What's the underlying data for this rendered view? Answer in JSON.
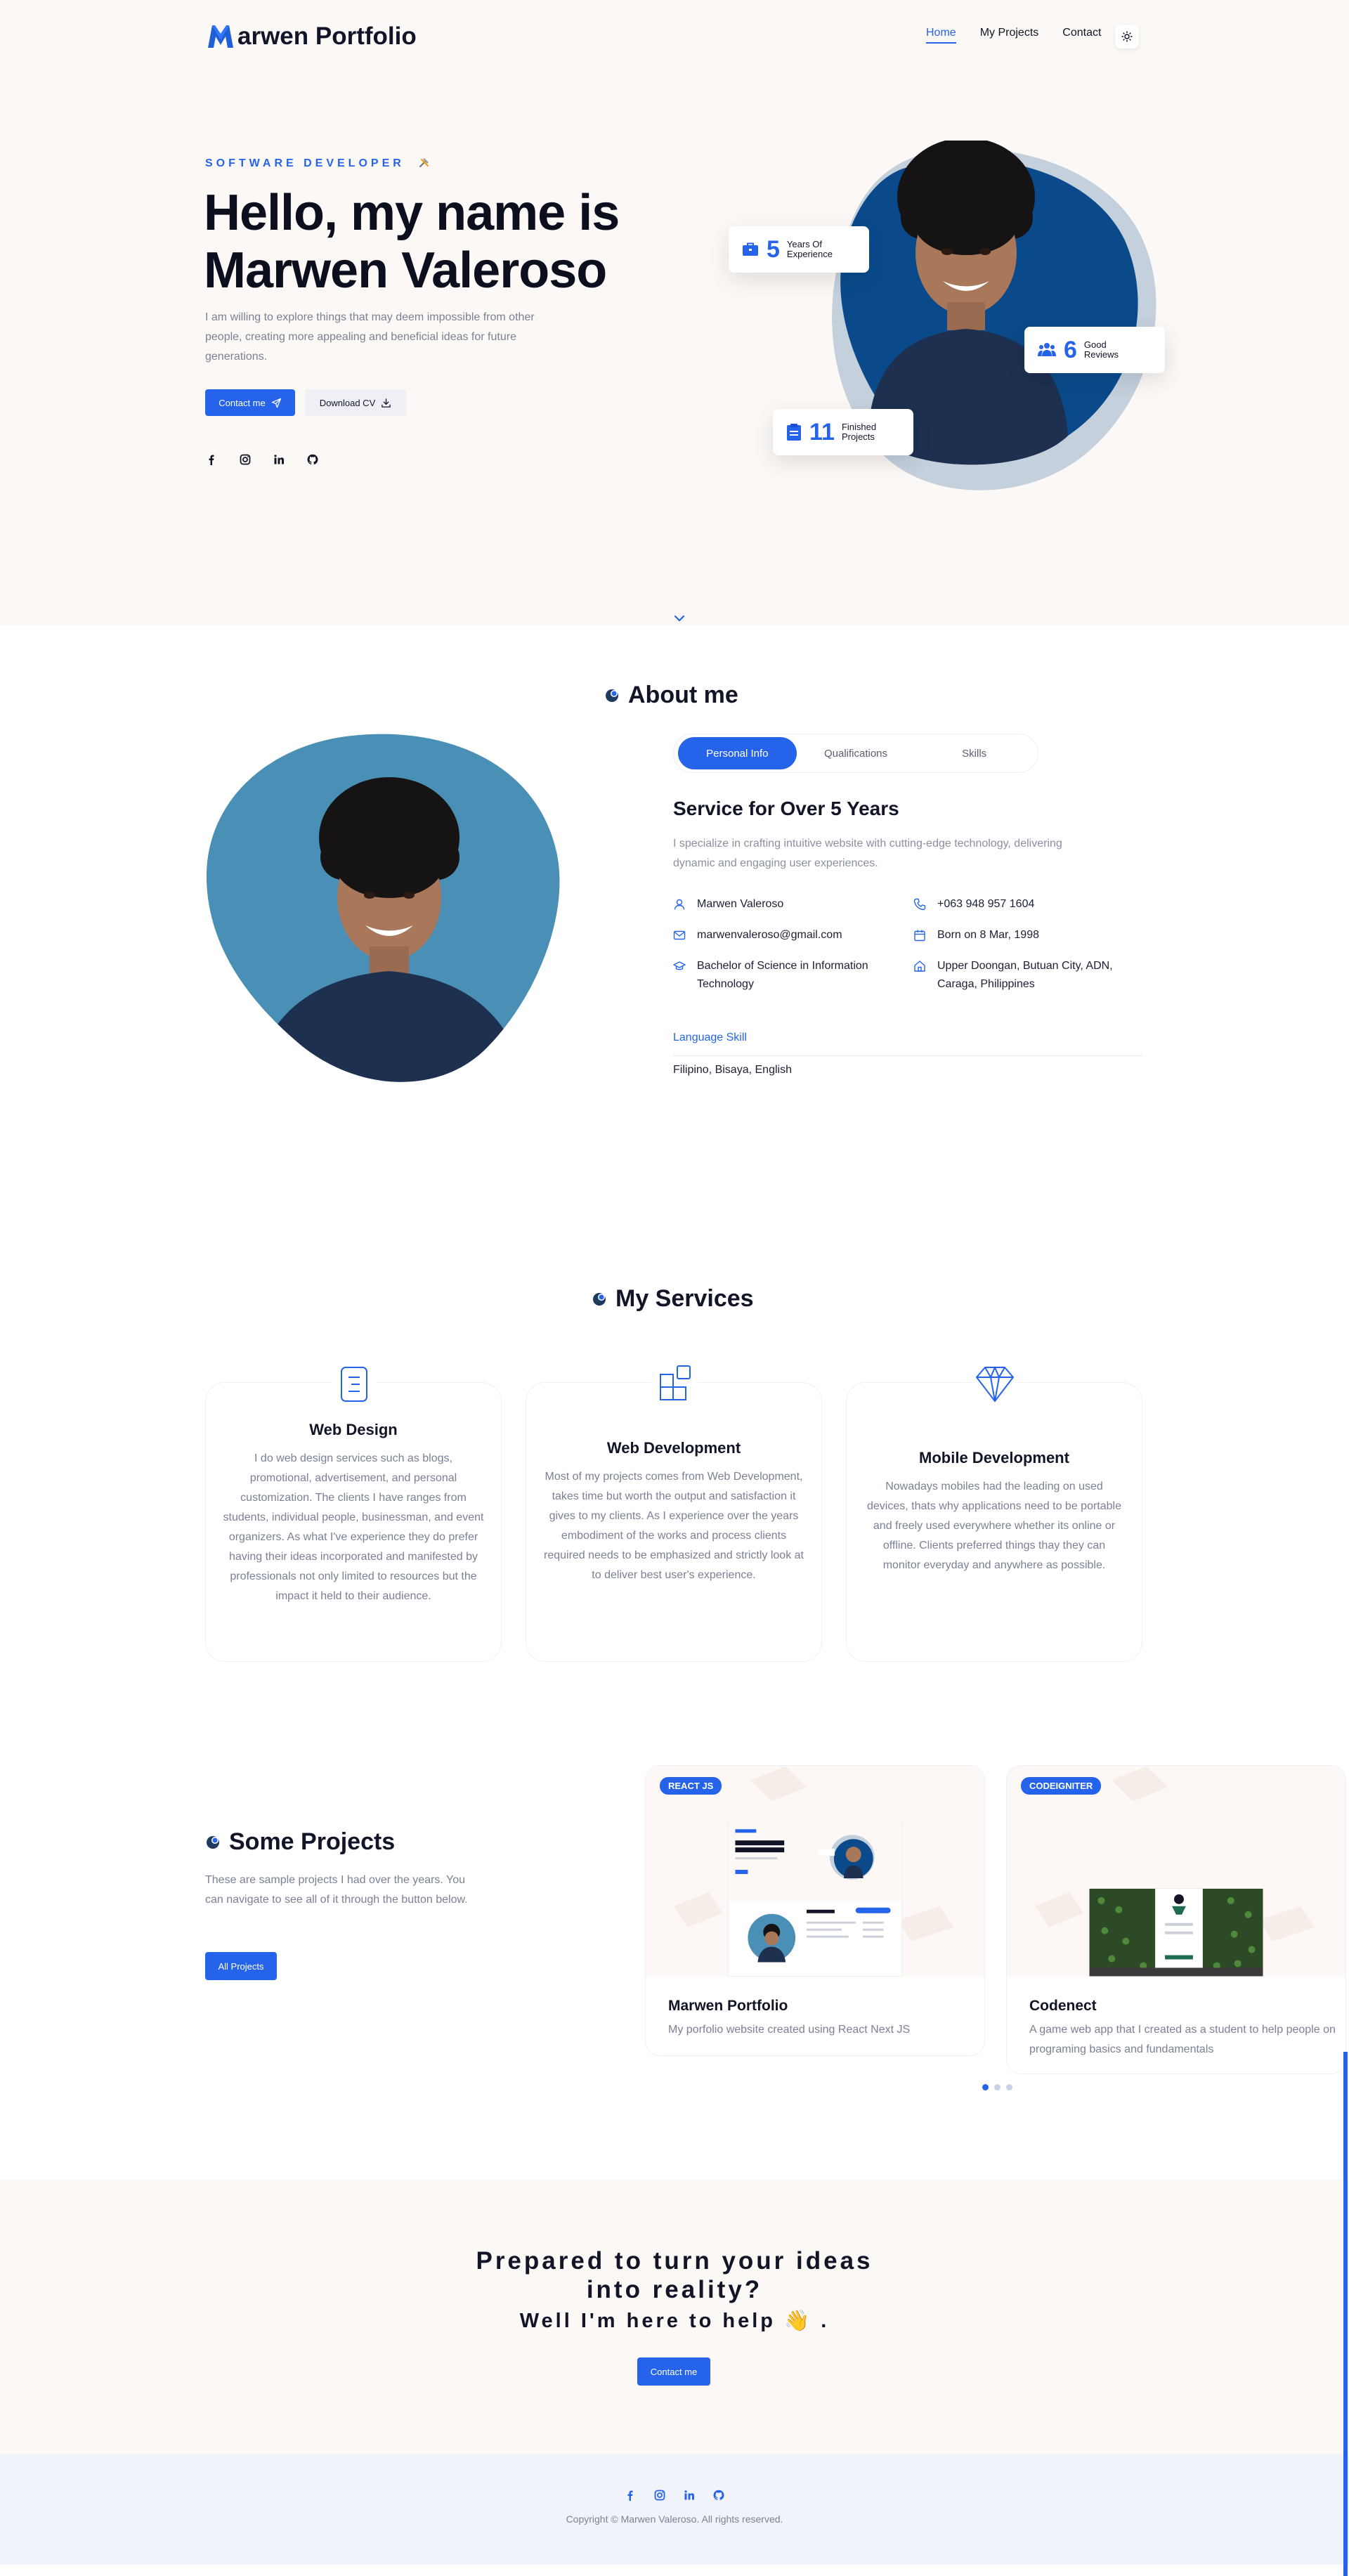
{
  "header": {
    "logo_text": "arwen Portfolio",
    "nav": [
      "Home",
      "My Projects",
      "Contact"
    ]
  },
  "hero": {
    "eyebrow": "SOFTWARE DEVELOPER",
    "title_line1": "Hello, my name is",
    "title_line2": "Marwen Valeroso",
    "description": "I am willing to explore things that may deem impossible from other people, creating more appealing and beneficial ideas for future generations.",
    "contact_btn": "Contact me",
    "download_btn": "Download CV",
    "stats": [
      {
        "num": "5",
        "label1": "Years Of",
        "label2": "Experience"
      },
      {
        "num": "6",
        "label1": "Good",
        "label2": "Reviews"
      },
      {
        "num": "11",
        "label1": "Finished",
        "label2": "Projects"
      }
    ]
  },
  "about": {
    "title": "About me",
    "tabs": [
      "Personal Info",
      "Qualifications",
      "Skills"
    ],
    "heading": "Service for Over 5 Years",
    "paragraph": "I specialize in crafting intuitive website with cutting-edge technology, delivering dynamic and engaging user experiences.",
    "info": {
      "name": "Marwen Valeroso",
      "phone": "+063 948 957 1604",
      "email": "marwenvaleroso@gmail.com",
      "born": "Born on 8 Mar, 1998",
      "education": "Bachelor of Science in Information Technology",
      "address": "Upper Doongan, Butuan City, ADN, Caraga, Philippines"
    },
    "language_label": "Language Skill",
    "languages": "Filipino, Bisaya, English"
  },
  "services": {
    "title": "My Services",
    "items": [
      {
        "title": "Web Design",
        "text": "I do web design services such as blogs, promotional, advertisement, and personal customization. The clients I have ranges from students, individual people, businessman, and event organizers. As what I've experience they do prefer having their ideas incorporated and manifested by professionals not only limited to resources but the impact it held to their audience."
      },
      {
        "title": "Web Development",
        "text": "Most of my projects comes from Web Development, takes time but worth the output and satisfaction it gives to my clients. As I experience over the years embodiment of the works and process clients required needs to be emphasized and strictly look at to deliver best user's experience."
      },
      {
        "title": "Mobile Development",
        "text": "Nowadays mobiles had the leading on used devices, thats why applications need to be portable and freely used everywhere whether its online or offline. Clients preferred things thay they can monitor everyday and anywhere as possible."
      }
    ]
  },
  "projects": {
    "title": "Some Projects",
    "description": "These are sample projects I had over the years. You can navigate to see all of it through the button below.",
    "all_btn": "All Projects",
    "items": [
      {
        "badge": "REACT JS",
        "title": "Marwen Portfolio",
        "text": "My porfolio website created using React Next JS"
      },
      {
        "badge": "CODEIGNITER",
        "title": "Codenect",
        "text": "A game web app that I created as a student to help people on programing basics and fundamentals"
      }
    ]
  },
  "cta": {
    "line1": "Prepared to turn your ideas",
    "line2": "into reality?",
    "line3": "Well I'm here to help",
    "wave_emoji": "👋",
    "line3_end": ".",
    "button": "Contact me"
  },
  "footer": {
    "copyright": "Copyright © Marwen Valeroso. All rights reserved."
  },
  "colors": {
    "accent": "#2563eb",
    "cream": "#fcf8f5",
    "footer": "#f0f3fa",
    "photo_bg": "#4a8fb5",
    "hero_blob": "#0a4a8a"
  }
}
